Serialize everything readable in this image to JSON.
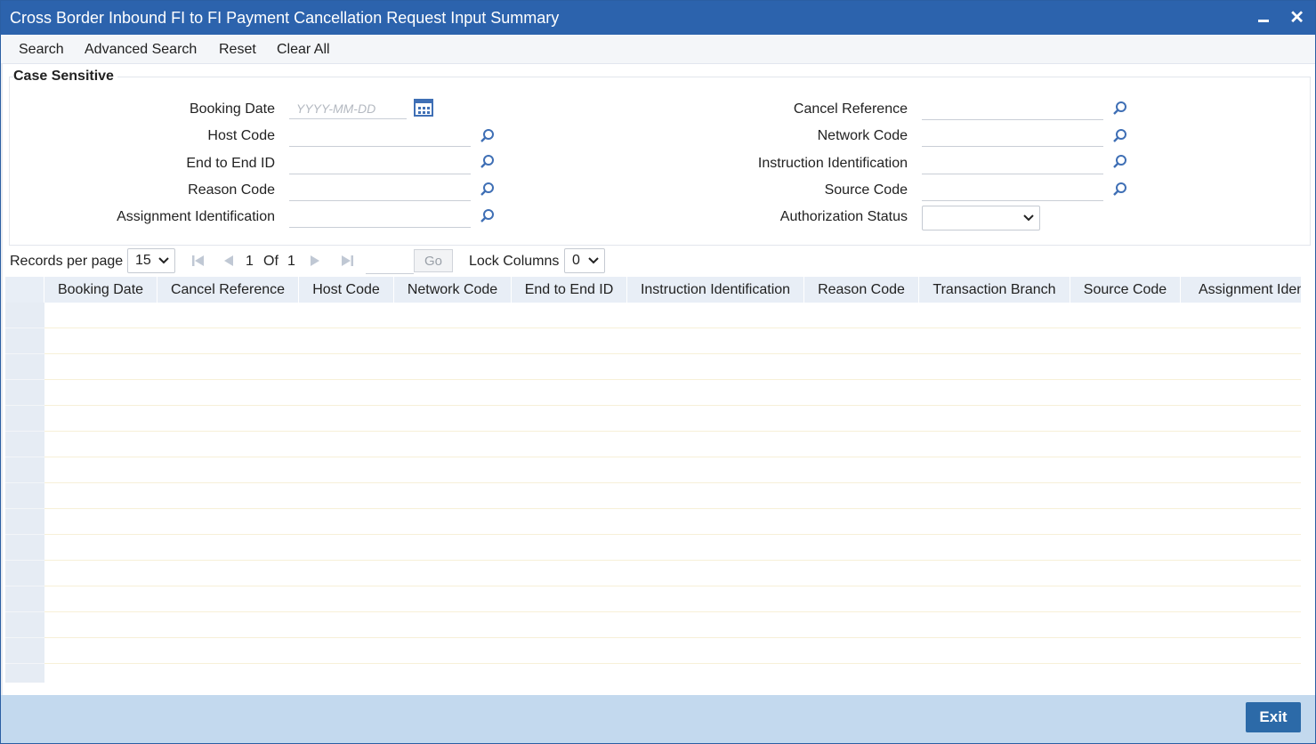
{
  "window": {
    "title": "Cross Border Inbound FI to FI Payment Cancellation Request Input Summary",
    "close_glyph": "✕"
  },
  "toolbar": {
    "search": "Search",
    "advanced_search": "Advanced Search",
    "reset": "Reset",
    "clear_all": "Clear All"
  },
  "criteria": {
    "legend": "Case Sensitive",
    "booking_date": {
      "label": "Booking Date",
      "placeholder": "YYYY-MM-DD"
    },
    "host_code": {
      "label": "Host Code"
    },
    "end_to_end_id": {
      "label": "End to End ID"
    },
    "reason_code": {
      "label": "Reason Code"
    },
    "assignment_identification": {
      "label": "Assignment Identification"
    },
    "cancel_reference": {
      "label": "Cancel Reference"
    },
    "network_code": {
      "label": "Network Code"
    },
    "instruction_identification": {
      "label": "Instruction Identification"
    },
    "source_code": {
      "label": "Source Code"
    },
    "authorization_status": {
      "label": "Authorization Status",
      "value": ""
    }
  },
  "pager": {
    "records_per_page_label": "Records per page",
    "records_per_page": "15",
    "current_page": "1",
    "of_label": "Of",
    "total_pages": "1",
    "go_label": "Go",
    "lock_columns_label": "Lock Columns",
    "lock_columns": "0"
  },
  "grid": {
    "columns": [
      "Booking Date",
      "Cancel Reference",
      "Host Code",
      "Network Code",
      "End to End ID",
      "Instruction Identification",
      "Reason Code",
      "Transaction Branch",
      "Source Code",
      "Assignment Identification"
    ],
    "row_count": 15
  },
  "footer": {
    "exit": "Exit"
  },
  "colors": {
    "titlebar": "#2c63ad",
    "grid_header": "#e8eef6",
    "footer": "#c3d9ee",
    "exit_button": "#2c6aa8",
    "icon": "#3f6fb5"
  }
}
